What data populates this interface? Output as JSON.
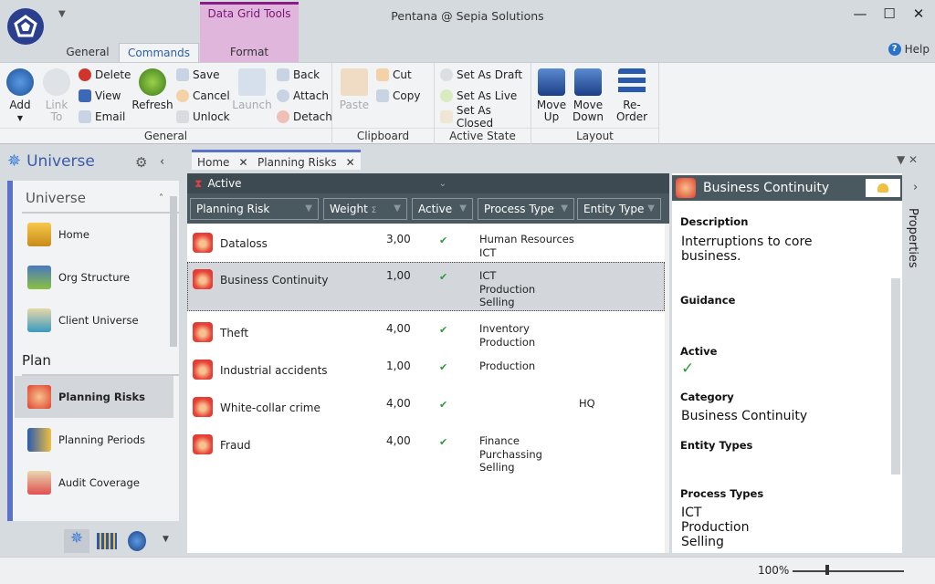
{
  "window": {
    "title": "Pentana @ Sepia Solutions",
    "controls": {
      "minimize": "—",
      "maximize": "☐",
      "close": "✕"
    }
  },
  "ribbon_tabs": {
    "contextual_group": "Data Grid Tools",
    "tabs": [
      "General",
      "Commands",
      "Format"
    ],
    "active": "Commands",
    "help": "Help"
  },
  "ribbon": {
    "general": {
      "label": "General",
      "add": "Add",
      "link_to": "Link To",
      "delete": "Delete",
      "view": "View",
      "email": "Email",
      "refresh": "Refresh",
      "save": "Save",
      "cancel": "Cancel",
      "unlock": "Unlock",
      "launch": "Launch",
      "back": "Back",
      "attach": "Attach",
      "detach": "Detach"
    },
    "clipboard": {
      "label": "Clipboard",
      "paste": "Paste",
      "cut": "Cut",
      "copy": "Copy"
    },
    "active_state": {
      "label": "Active State",
      "draft": "Set As Draft",
      "live": "Set As Live",
      "closed": "Set As Closed"
    },
    "layout": {
      "label": "Layout",
      "move_up": "Move Up",
      "move_down": "Move Down",
      "reorder": "Re-Order"
    }
  },
  "nav": {
    "title": "Universe",
    "sections": [
      {
        "title": "Universe",
        "items": [
          "Home",
          "Org Structure",
          "Client Universe"
        ]
      },
      {
        "title": "Plan",
        "items": [
          "Planning Risks",
          "Planning Periods",
          "Audit Coverage"
        ]
      }
    ],
    "selected": "Planning Risks"
  },
  "doc_tabs": [
    {
      "label": "Home"
    },
    {
      "label": "Planning Risks"
    }
  ],
  "grid": {
    "filter": "Active",
    "columns": [
      "Planning Risk",
      "Weight",
      "Active",
      "Process Type",
      "Entity Type"
    ],
    "weight_sum_symbol": "Σ",
    "rows": [
      {
        "name": "Dataloss",
        "weight": "3,00",
        "active": "✔",
        "process_types": "Human Resources\nICT",
        "entity_type": ""
      },
      {
        "name": "Business Continuity",
        "weight": "1,00",
        "active": "✔",
        "process_types": "ICT\nProduction\nSelling",
        "entity_type": "",
        "selected": true
      },
      {
        "name": "Theft",
        "weight": "4,00",
        "active": "✔",
        "process_types": "Inventory\nProduction",
        "entity_type": ""
      },
      {
        "name": "Industrial accidents",
        "weight": "1,00",
        "active": "✔",
        "process_types": "Production",
        "entity_type": ""
      },
      {
        "name": "White-collar crime",
        "weight": "4,00",
        "active": "✔",
        "process_types": "",
        "entity_type": "HQ"
      },
      {
        "name": "Fraud",
        "weight": "4,00",
        "active": "✔",
        "process_types": "Finance\nPurchassing\nSelling",
        "entity_type": ""
      }
    ]
  },
  "properties": {
    "title": "Business Continuity",
    "side_label": "Properties",
    "description_label": "Description",
    "description": "Interruptions to core business.",
    "guidance_label": "Guidance",
    "guidance": "",
    "active_label": "Active",
    "active": "✓",
    "category_label": "Category",
    "category": "Business Continuity",
    "entity_types_label": "Entity Types",
    "entity_types": "",
    "process_types_label": "Process Types",
    "process_types": "ICT\nProduction\nSelling"
  },
  "status": {
    "zoom": "100%"
  }
}
